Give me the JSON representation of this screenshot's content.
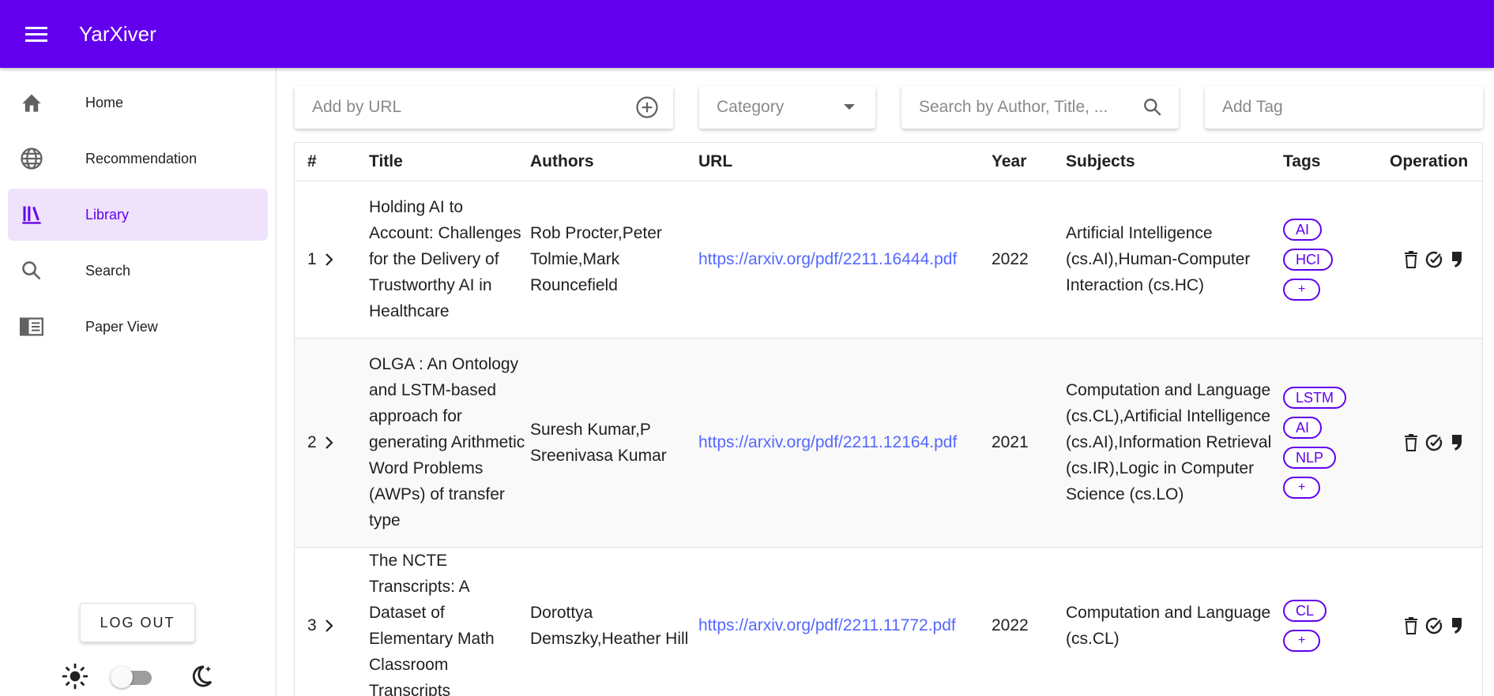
{
  "app": {
    "title": "YarXiver"
  },
  "sidebar": {
    "items": [
      {
        "label": "Home",
        "icon": "home-icon"
      },
      {
        "label": "Recommendation",
        "icon": "globe-icon"
      },
      {
        "label": "Library",
        "icon": "library-icon",
        "active": true
      },
      {
        "label": "Search",
        "icon": "search-icon"
      },
      {
        "label": "Paper View",
        "icon": "paper-view-icon"
      }
    ],
    "logout_label": "LOG OUT",
    "theme_toggle": {
      "dark_mode": false
    }
  },
  "toolbar": {
    "url_placeholder": "Add by URL",
    "category_placeholder": "Category",
    "search_placeholder": "Search by Author, Title, ...",
    "tag_placeholder": "Add Tag"
  },
  "table": {
    "headers": [
      "#",
      "",
      "Title",
      "Authors",
      "URL",
      "Year",
      "Subjects",
      "Tags",
      "Operation"
    ],
    "rows": [
      {
        "num": "1",
        "title": "Holding AI to Account: Challenges for the Delivery of Trustworthy AI in Healthcare",
        "authors": "Rob Procter,Peter Tolmie,Mark Rouncefield",
        "url": "https://arxiv.org/pdf/2211.16444.pdf",
        "year": "2022",
        "subjects": "Artificial Intelligence (cs.AI),Human-Computer Interaction (cs.HC)",
        "tags": [
          "AI",
          "HCI"
        ]
      },
      {
        "num": "2",
        "title": "OLGA : An Ontology and LSTM-based approach for generating Arithmetic Word Problems (AWPs) of transfer type",
        "authors": "Suresh Kumar,P Sreenivasa Kumar",
        "url": "https://arxiv.org/pdf/2211.12164.pdf",
        "year": "2021",
        "subjects": "Computation and Language (cs.CL),Artificial Intelligence (cs.AI),Information Retrieval (cs.IR),Logic in Computer Science (cs.LO)",
        "tags": [
          "LSTM",
          "AI",
          "NLP"
        ]
      },
      {
        "num": "3",
        "title": "The NCTE Transcripts: A Dataset of Elementary Math Classroom Transcripts",
        "authors": "Dorottya Demszky,Heather Hill",
        "url": "https://arxiv.org/pdf/2211.11772.pdf",
        "year": "2022",
        "subjects": "Computation and Language (cs.CL)",
        "tags": [
          "CL"
        ]
      }
    ],
    "add_tag_label": "+"
  },
  "colors": {
    "primary": "#6200ee",
    "link": "#5468ff",
    "active_bg": "#efe3fc"
  }
}
